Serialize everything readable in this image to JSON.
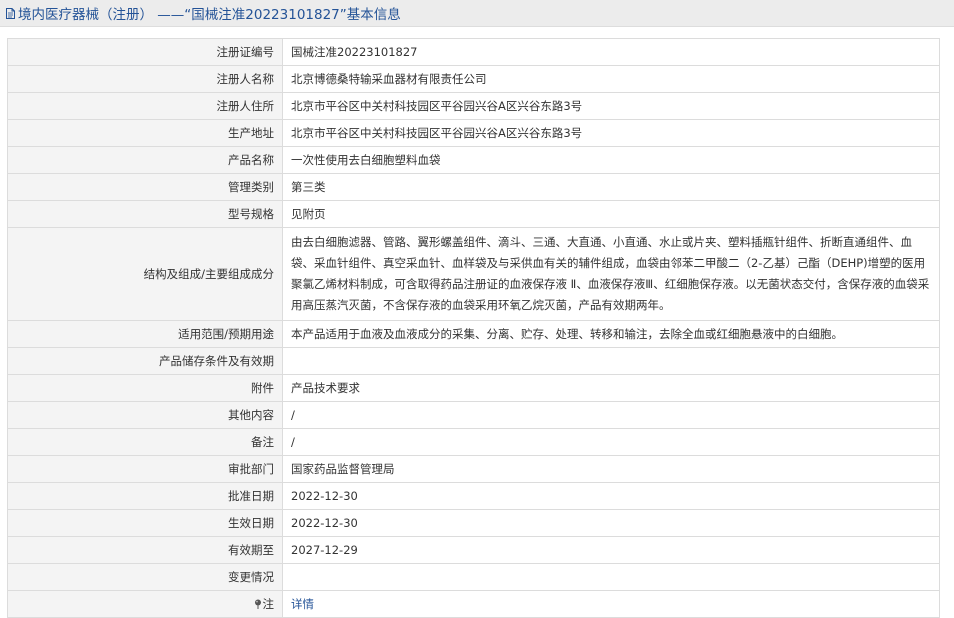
{
  "page": {
    "title": "境内医疗器械（注册） ——“国械注准20223101827”基本信息"
  },
  "icons": {
    "title_icon": "document-icon",
    "note_icon": "pin-icon"
  },
  "colors": {
    "title_text": "#245397",
    "link": "#245397",
    "label_bg": "#f4f4f4",
    "border": "#dcdcdc",
    "title_bar_bg": "#ececec"
  },
  "rows": [
    {
      "label": "注册证编号",
      "value": "国械注准20223101827"
    },
    {
      "label": "注册人名称",
      "value": "北京博德桑特输采血器材有限责任公司"
    },
    {
      "label": "注册人住所",
      "value": "北京市平谷区中关村科技园区平谷园兴谷A区兴谷东路3号"
    },
    {
      "label": "生产地址",
      "value": "北京市平谷区中关村科技园区平谷园兴谷A区兴谷东路3号"
    },
    {
      "label": "产品名称",
      "value": "一次性使用去白细胞塑料血袋"
    },
    {
      "label": "管理类别",
      "value": "第三类"
    },
    {
      "label": "型号规格",
      "value": "见附页"
    },
    {
      "label": "结构及组成/主要组成成分",
      "value": "由去白细胞滤器、管路、翼形螺盖组件、滴斗、三通、大直通、小直通、水止或片夹、塑料插瓶针组件、折断直通组件、血袋、采血针组件、真空采血针、血样袋及与采供血有关的辅件组成，血袋由邻苯二甲酸二（2-乙基）己酯（DEHP)增塑的医用聚氯乙烯材料制成，可含取得药品注册证的血液保存液 Ⅱ、血液保存液Ⅲ、红细胞保存液。以无菌状态交付，含保存液的血袋采用高压蒸汽灭菌，不含保存液的血袋采用环氧乙烷灭菌，产品有效期两年。"
    },
    {
      "label": "适用范围/预期用途",
      "value": "本产品适用于血液及血液成分的采集、分离、贮存、处理、转移和输注，去除全血或红细胞悬液中的白细胞。"
    },
    {
      "label": "产品储存条件及有效期",
      "value": ""
    },
    {
      "label": "附件",
      "value": "产品技术要求"
    },
    {
      "label": "其他内容",
      "value": "/"
    },
    {
      "label": "备注",
      "value": "/"
    },
    {
      "label": "审批部门",
      "value": "国家药品监督管理局"
    },
    {
      "label": "批准日期",
      "value": "2022-12-30"
    },
    {
      "label": "生效日期",
      "value": "2022-12-30"
    },
    {
      "label": "有效期至",
      "value": "2027-12-29"
    },
    {
      "label": "变更情况",
      "value": ""
    }
  ],
  "note_row": {
    "label": "注",
    "link_text": "详情"
  }
}
